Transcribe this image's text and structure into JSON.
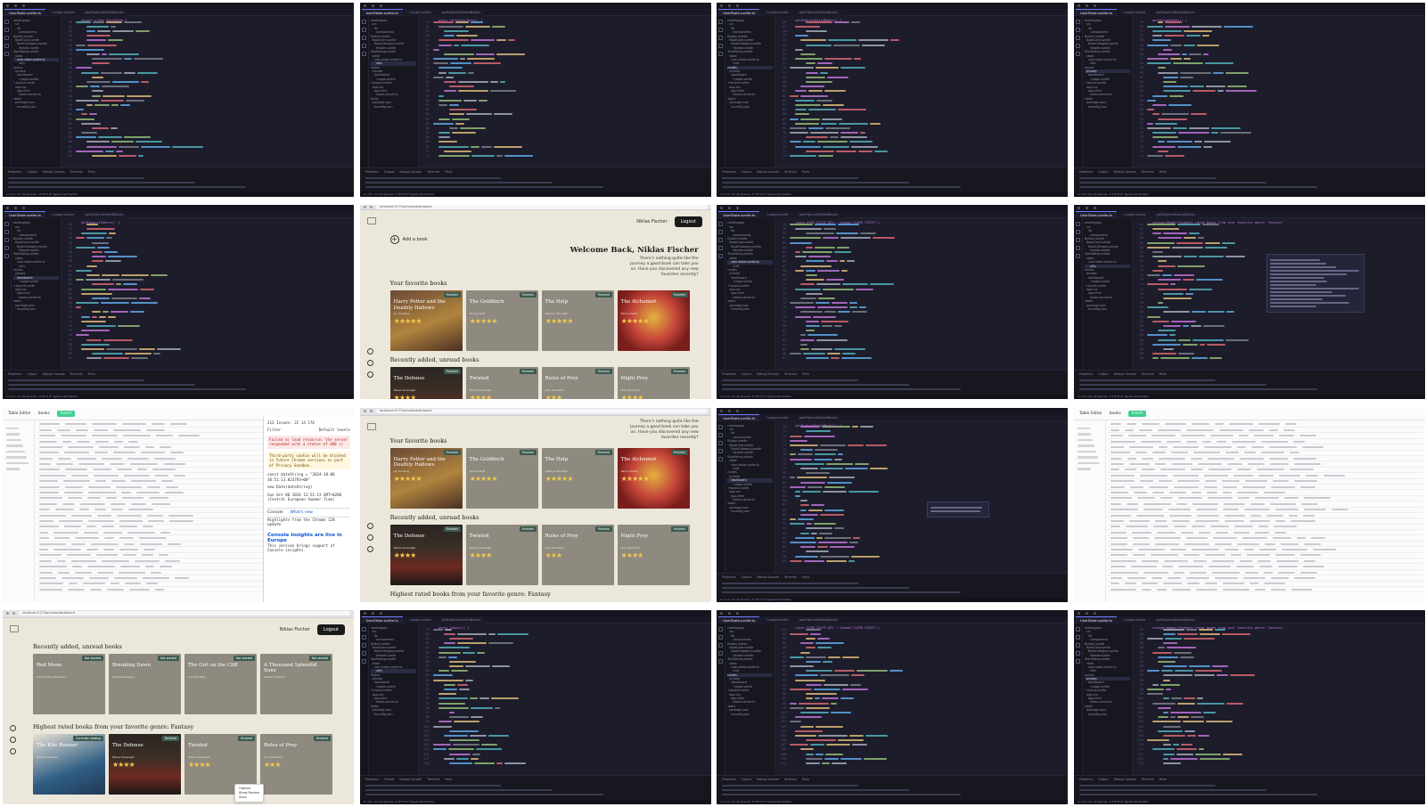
{
  "app": {
    "user_name": "Niklas Fischer",
    "logout_label": "Logout",
    "add_book_label": "Add a book",
    "welcome_title": "Welcome Back, Niklas Fischer",
    "welcome_text": "There's nothing quite like the journey a good book can take you on. Have you discovered any new favorites recently?",
    "section_favorites": "Your favorite books",
    "section_recent": "Recently added, unread books",
    "section_highest": "Highest rated books from your favorite genre: Fantasy",
    "url": "localhost:5173/private/dashboard",
    "favorites": [
      {
        "title": "Harry Potter and the Deathly Hallows",
        "author": "J.K. Rowling",
        "badge": "Finished",
        "rating": 5,
        "cover": "hp"
      },
      {
        "title": "The Goldfinch",
        "author": "Donna Tartt",
        "badge": "Finished",
        "rating": 5,
        "cover": "plain"
      },
      {
        "title": "The Help",
        "author": "Kathryn Stockett",
        "badge": "Finished",
        "rating": 5,
        "cover": "plain"
      },
      {
        "title": "The Alchemist",
        "author": "Paulo Coelho",
        "badge": "Finished",
        "rating": 5,
        "cover": "alch"
      }
    ],
    "recent": [
      {
        "title": "The Defense",
        "author": "Steve Cavanagh",
        "badge": "Finished",
        "rating": 4,
        "cover": "def"
      },
      {
        "title": "Twisted",
        "author": "Steve Cavanagh",
        "badge": "Finished",
        "rating": 4,
        "cover": "plain"
      },
      {
        "title": "Rules of Prey",
        "author": "John Sandford",
        "badge": "Finished",
        "rating": 3,
        "cover": "plain"
      },
      {
        "title": "Night Prey",
        "author": "John Sandford",
        "badge": "Finished",
        "rating": 4,
        "cover": "plain"
      }
    ],
    "unread": [
      {
        "title": "Red Moon",
        "author": "Kim Stanley Robinson",
        "badge": "Not started"
      },
      {
        "title": "Breaking Dawn",
        "author": "Stephenie Meyer",
        "badge": "Not started"
      },
      {
        "title": "The Girl on the Cliff",
        "author": "Lucinda Riley",
        "badge": "Not started"
      },
      {
        "title": "A Thousand Splendid Suns",
        "author": "Khaled Hosseini",
        "badge": "Not started"
      }
    ],
    "fantasy": [
      {
        "title": "The Kite Runner",
        "author": "Khaled Hosseini",
        "badge": "Currently reading",
        "rating": 0,
        "cover": "kite"
      },
      {
        "title": "The Defense",
        "author": "Steve Cavanagh",
        "badge": "Finished",
        "rating": 4,
        "cover": "def"
      },
      {
        "title": "Twisted",
        "author": "Steve Cavanagh",
        "badge": "Finished",
        "rating": 4,
        "cover": "plain"
      },
      {
        "title": "Rules of Prey",
        "author": "John Sandford",
        "badge": "Finished",
        "rating": 3,
        "cover": "plain"
      }
    ],
    "context_menu": [
      "Options",
      "Show Review",
      "Save"
    ]
  },
  "editor": {
    "file_tab": "UserState.svelte.ts",
    "tab2": "+page.svelte",
    "tab3": "getHighestRatedBooks",
    "status": "Ln 111, Col 42   Spaces: 2   UTF-8   LF   TypeScript   Prettier",
    "panel_tabs": [
      "Problems",
      "Output",
      "Debug Console",
      "Terminal",
      "Ports"
    ],
    "tree": [
      "readingapp",
      "src",
      "lib",
      "components",
      "Button.svelte",
      "BookCard.svelte",
      "BookCategory.svelte",
      "Header.svelte",
      "StarRating.svelte",
      "state",
      "user-state.svelte.ts",
      "utils",
      "routes",
      "private",
      "dashboard",
      "+page.svelte",
      "+layout.svelte",
      "app.css",
      "app.html",
      "hooks.server.ts",
      "static",
      "package.json",
      "tsconfig.json"
    ],
    "code_snippets": [
      "export class UserState {",
      "async fetchUserData() {",
      "getHighestRatedBooks() {",
      "getUnreadBooks() {",
      "getFavoriteGenre() {",
      "async logout() {",
      "const USER_STATE_KEY = Symbol(\"USER_STATE\");",
      "categoryName=\"Highest rated books from your favorite genre: Fantasy\""
    ]
  },
  "devtools": {
    "issues": "212 Issues: 22  14  176",
    "filter": "Filter",
    "levels": "Default levels",
    "error": "Failed to load resource: the server responded with a status of 400 ()",
    "warning": "Third-party cookie will be blocked in future Chrome versions as part of Privacy Sandbox.",
    "log1": "const dateString = \"2024-10-06 10:51:13.023793+00\"",
    "log2": "new Date(dateString)",
    "log3": "Sun Oct 06 2024 12:51:13 GMT+0200 (Central European Summer Time)",
    "tabs": [
      "Console",
      "What's new"
    ],
    "whatsnew": "Highlights from the Chrome 128 update",
    "insight_title": "Console insights are live in Europe",
    "insight_text": "This version brings support of Console insights."
  },
  "table_editor": {
    "title": "Table Editor",
    "tab_books": "books",
    "tab_insert": "Insert"
  }
}
